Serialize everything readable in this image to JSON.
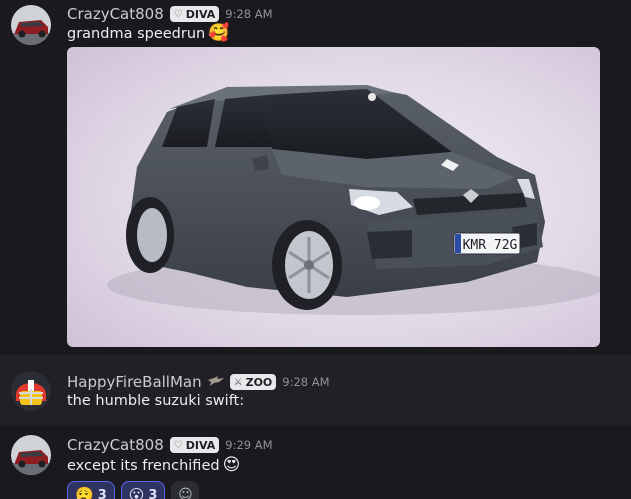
{
  "messages": [
    {
      "username": "CrazyCat808",
      "tag": "DIVA",
      "tag_icon": "heart-icon",
      "time": "9:28 AM",
      "text": "grandma speedrun",
      "emoji": "🥰",
      "attachment": {
        "kind": "car-render-image",
        "plate": "KMR 72G"
      }
    },
    {
      "username": "HappyFireBallMan",
      "badge_icon": "eagle-icon",
      "tag": "ZOO",
      "tag_icon": "swords-icon",
      "time": "9:28 AM",
      "text": "the humble suzuki swift:"
    },
    {
      "username": "CrazyCat808",
      "tag": "DIVA",
      "tag_icon": "heart-icon",
      "time": "9:29 AM",
      "text": "except its frenchified",
      "emoji": "😍",
      "reactions": [
        {
          "emoji": "😮‍💨",
          "count": "3"
        },
        {
          "emoji": "😮",
          "count": "3"
        }
      ]
    }
  ],
  "colors": {
    "background": "#1a1a1e",
    "highlight_row": "#202025",
    "reaction_border": "#5865f2",
    "car_body": "#4c525c"
  }
}
